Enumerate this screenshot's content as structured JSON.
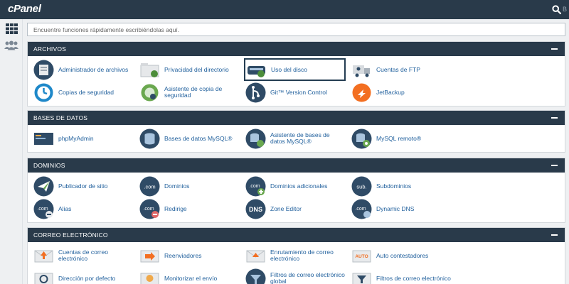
{
  "brand": {
    "logo": "cPanel"
  },
  "topbar": {
    "user_hint": "B"
  },
  "search": {
    "placeholder": "Encuentre funciones rápidamente escribiéndolas aquí."
  },
  "sections": {
    "archivos": {
      "title": "ARCHIVOS",
      "items": [
        {
          "label": "Administrador de archivos",
          "icon": "file-manager-icon"
        },
        {
          "label": "Privacidad del directorio",
          "icon": "folder-lock-icon"
        },
        {
          "label": "Uso del disco",
          "icon": "disk-usage-icon"
        },
        {
          "label": "Cuentas de FTP",
          "icon": "ftp-truck-icon"
        },
        {
          "label": "Copias de seguridad",
          "icon": "backup-clock-icon"
        },
        {
          "label": "Asistente de copia de seguridad",
          "icon": "backup-wizard-icon"
        },
        {
          "label": "Git™ Version Control",
          "icon": "git-icon"
        },
        {
          "label": "JetBackup",
          "icon": "jetbackup-icon"
        }
      ]
    },
    "bases": {
      "title": "BASES DE DATOS",
      "items": [
        {
          "label": "phpMyAdmin",
          "icon": "phpmyadmin-icon"
        },
        {
          "label": "Bases de datos MySQL®",
          "icon": "database-icon"
        },
        {
          "label": "Asistente de bases de datos MySQL®",
          "icon": "database-wizard-icon"
        },
        {
          "label": "MySQL remoto®",
          "icon": "remote-database-icon"
        }
      ]
    },
    "dominios": {
      "title": "DOMINIOS",
      "items": [
        {
          "label": "Publicador de sitio",
          "icon": "paper-plane-icon"
        },
        {
          "label": "Dominios",
          "icon": "dotcom-icon",
          "badge": ".com"
        },
        {
          "label": "Dominios adicionales",
          "icon": "dotcom-plus-icon",
          "badge": ".com"
        },
        {
          "label": "Subdominios",
          "icon": "subdomain-icon",
          "badge": "sub."
        },
        {
          "label": "Alias",
          "icon": "alias-icon",
          "badge": ".com"
        },
        {
          "label": "Redirige",
          "icon": "redirect-icon",
          "badge": ".com"
        },
        {
          "label": "Zone Editor",
          "icon": "dns-icon",
          "badge": "DNS"
        },
        {
          "label": "Dynamic DNS",
          "icon": "dynamic-dns-icon",
          "badge": ".com"
        }
      ]
    },
    "correo": {
      "title": "CORREO ELECTRÓNICO",
      "items": [
        {
          "label": "Cuentas de correo electrónico",
          "icon": "email-accounts-icon"
        },
        {
          "label": "Reenviadores",
          "icon": "forwarders-icon"
        },
        {
          "label": "Enrutamiento de correo electrónico",
          "icon": "email-routing-icon"
        },
        {
          "label": "Auto contestadores",
          "icon": "autoresponder-icon",
          "badge": "AUTO"
        },
        {
          "label": "Dirección por defecto",
          "icon": "default-address-icon"
        },
        {
          "label": "Monitorizar el envío",
          "icon": "track-delivery-icon"
        },
        {
          "label": "Filtros de correo electrónico global",
          "icon": "global-filter-icon"
        },
        {
          "label": "Filtros de correo electrónico",
          "icon": "email-filter-icon"
        }
      ]
    }
  },
  "colors": {
    "header": "#293a4a",
    "link": "#1f5f9c",
    "page": "#eef0f2"
  }
}
